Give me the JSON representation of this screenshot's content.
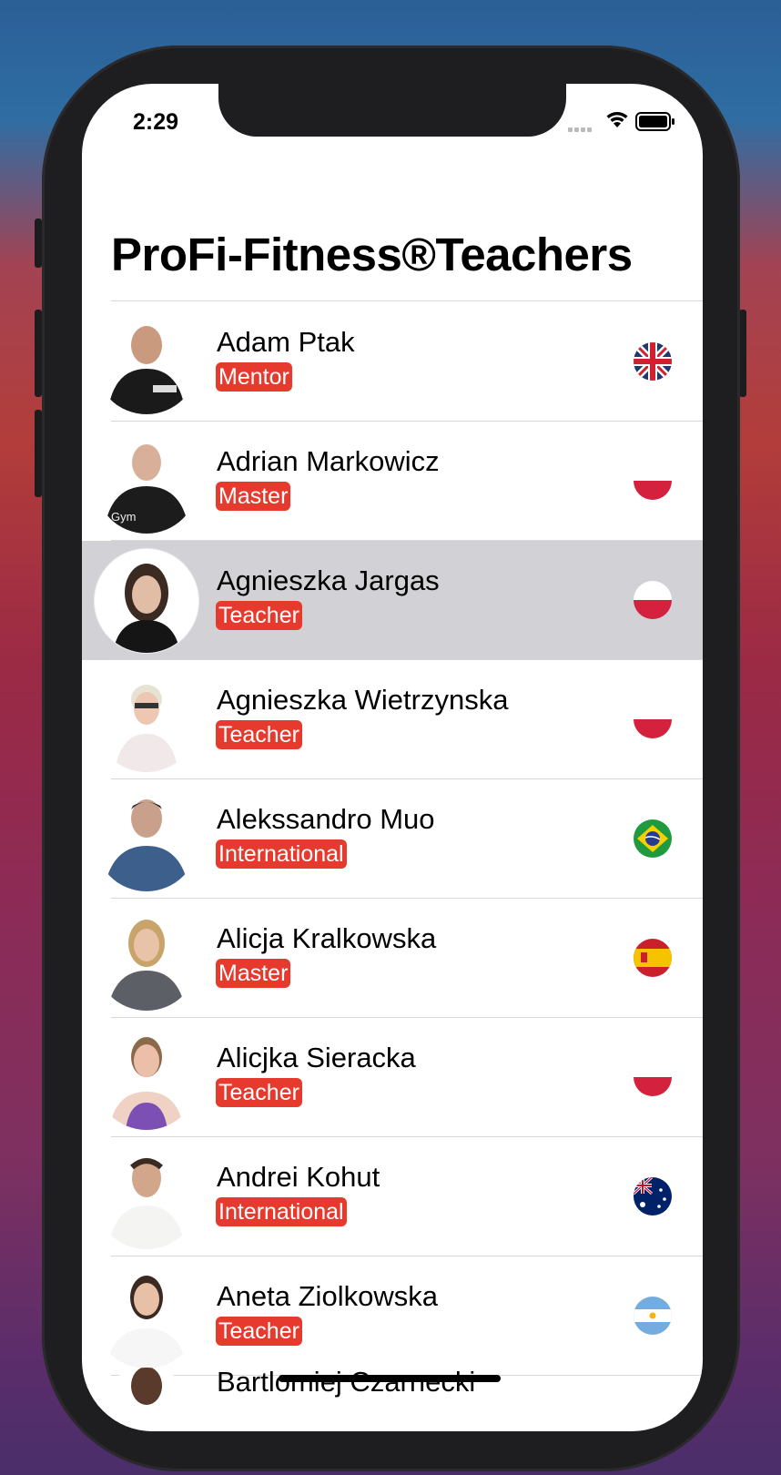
{
  "status_bar": {
    "time": "2:29"
  },
  "page_title": "ProFi-Fitness®Teachers",
  "teachers": [
    {
      "name": "Adam Ptak",
      "level": "Mentor",
      "flag": "uk-flag"
    },
    {
      "name": "Adrian Markowicz",
      "level": "Master",
      "flag": "poland-flag"
    },
    {
      "name": "Agnieszka Jargas",
      "level": "Teacher",
      "flag": "poland-flag",
      "selected": true
    },
    {
      "name": "Agnieszka Wietrzynska",
      "level": "Teacher",
      "flag": "poland-flag"
    },
    {
      "name": "Alekssandro Muo",
      "level": "International",
      "flag": "brazil-flag"
    },
    {
      "name": "Alicja Kralkowska",
      "level": "Master",
      "flag": "spain-flag"
    },
    {
      "name": "Alicjka Sieracka",
      "level": "Teacher",
      "flag": "poland-flag"
    },
    {
      "name": "Andrei Kohut",
      "level": "International",
      "flag": "australia-flag"
    },
    {
      "name": "Aneta Ziolkowska",
      "level": "Teacher",
      "flag": "argentina-flag"
    }
  ],
  "partial_next": "Bartlomiej Czarnecki",
  "colors": {
    "badge": "#e63a2e",
    "selected_row": "#d1d1d6",
    "separator": "#d8d8dc"
  }
}
